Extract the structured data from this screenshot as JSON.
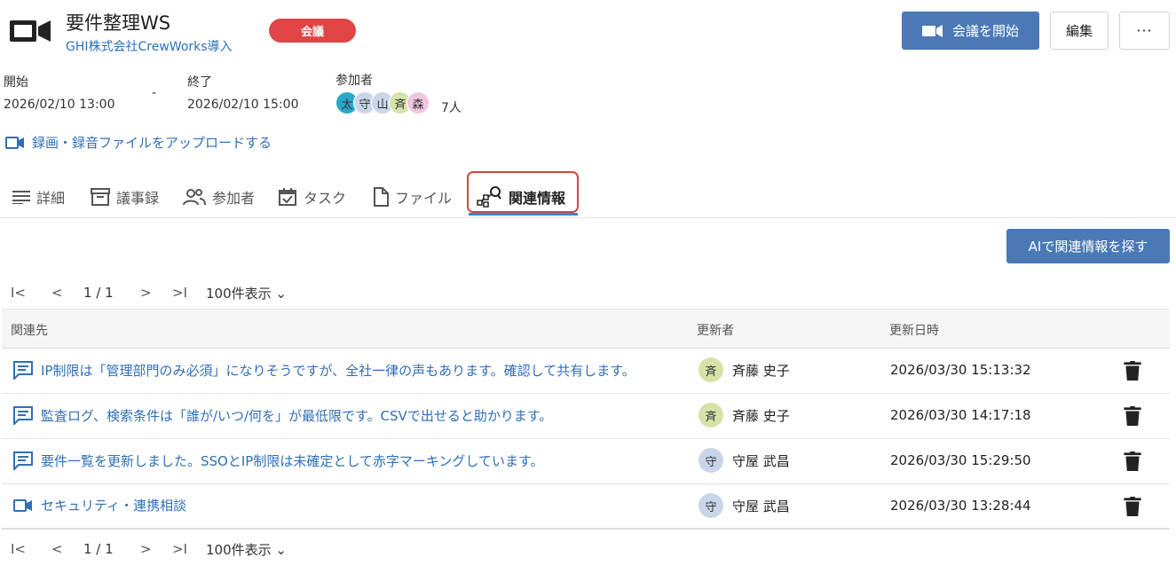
{
  "meeting": {
    "title": "要件整理WS",
    "project_link": "GHI株式会社CrewWorks導入",
    "type_badge": "会議",
    "badge_color": "#e04545"
  },
  "actions": {
    "start_label": "会議を開始",
    "edit_label": "編集",
    "more_label": "···"
  },
  "schedule": {
    "start_label": "開始",
    "start_value": "2026/02/10 13:00",
    "separator": "-",
    "end_label": "終了",
    "end_value": "2026/02/10 15:00"
  },
  "participants": {
    "label": "参加者",
    "avatars": [
      {
        "initial": "太",
        "color": "#29a8c9"
      },
      {
        "initial": "守",
        "color": "#c9d6ea"
      },
      {
        "initial": "山",
        "color": "#c9d6ea"
      },
      {
        "initial": "斉",
        "color": "#d6e3a8"
      },
      {
        "initial": "森",
        "color": "#f1c6df"
      }
    ],
    "count": "7人"
  },
  "upload_link": "録画・録音ファイルをアップロードする",
  "tabs": [
    {
      "label": "詳細",
      "icon": "list-icon"
    },
    {
      "label": "議事録",
      "icon": "archive-icon"
    },
    {
      "label": "参加者",
      "icon": "people-icon"
    },
    {
      "label": "タスク",
      "icon": "calendar-check-icon"
    },
    {
      "label": "ファイル",
      "icon": "file-icon"
    },
    {
      "label": "関連情報",
      "icon": "related-search-icon",
      "active": true
    }
  ],
  "ai_button": "AIで関連情報を探す",
  "pager": {
    "page": "1 / 1",
    "per_page": "100件表示"
  },
  "table": {
    "headers": [
      "関連先",
      "更新者",
      "更新日時"
    ],
    "rows": [
      {
        "icon": "comment-icon",
        "text": "IP制限は「管理部門のみ必須」になりそうですが、全社一律の声もあります。確認して共有します。",
        "user_initial": "斉",
        "user_color": "#d6e3a8",
        "user": "斉藤 史子",
        "date": "2026/03/30 15:13:32"
      },
      {
        "icon": "comment-icon",
        "text": "監査ログ、検索条件は「誰が/いつ/何を」が最低限です。CSVで出せると助かります。",
        "user_initial": "斉",
        "user_color": "#d6e3a8",
        "user": "斉藤 史子",
        "date": "2026/03/30 14:17:18"
      },
      {
        "icon": "comment-icon",
        "text": "要件一覧を更新しました。SSOとIP制限は未確定として赤字マーキングしています。",
        "user_initial": "守",
        "user_color": "#c9d6ea",
        "user": "守屋 武昌",
        "date": "2026/03/30 15:29:50"
      },
      {
        "icon": "video-icon",
        "text": "セキュリティ・連携相談",
        "user_initial": "守",
        "user_color": "#c9d6ea",
        "user": "守屋 武昌",
        "date": "2026/03/30 13:28:44"
      }
    ]
  },
  "colors": {
    "primary": "#4a79b5",
    "link": "#2f6fb8",
    "tab_active_underline": "#3b86d0",
    "highlight_border": "#d4473d"
  }
}
